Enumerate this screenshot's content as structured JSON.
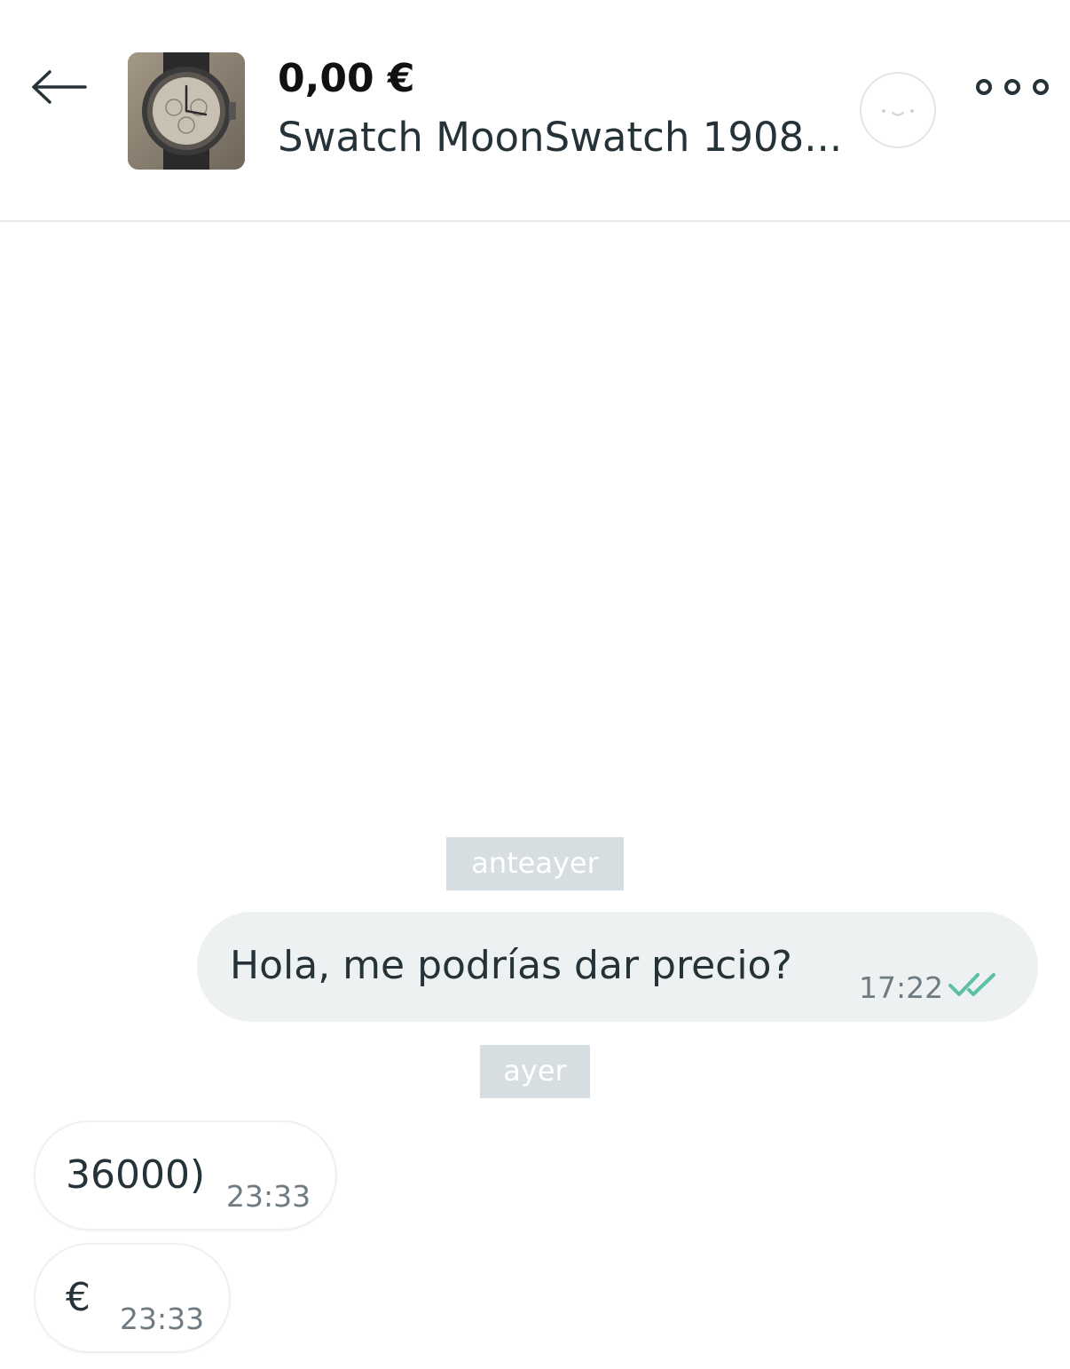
{
  "header": {
    "price": "0,00 €",
    "title": "Swatch MoonSwatch 1908...",
    "product_image": "watch-photo",
    "back_icon": "arrow-left-icon",
    "avatar_icon": "user-avatar-placeholder",
    "more_icon": "more-dots-icon"
  },
  "chat": {
    "groups": [
      {
        "date_label": "anteayer",
        "messages": [
          {
            "direction": "outgoing",
            "text": "Hola,  me podrías dar precio?",
            "time": "17:22",
            "status": "read"
          }
        ]
      },
      {
        "date_label": "ayer",
        "messages": [
          {
            "direction": "incoming",
            "text": "36000)",
            "time": "23:33"
          },
          {
            "direction": "incoming",
            "text": "€",
            "time": "23:33"
          }
        ]
      }
    ]
  },
  "colors": {
    "read_check": "#5bc0a6",
    "date_chip_bg": "#d6dee2",
    "outgoing_bubble": "#eef1f2"
  }
}
